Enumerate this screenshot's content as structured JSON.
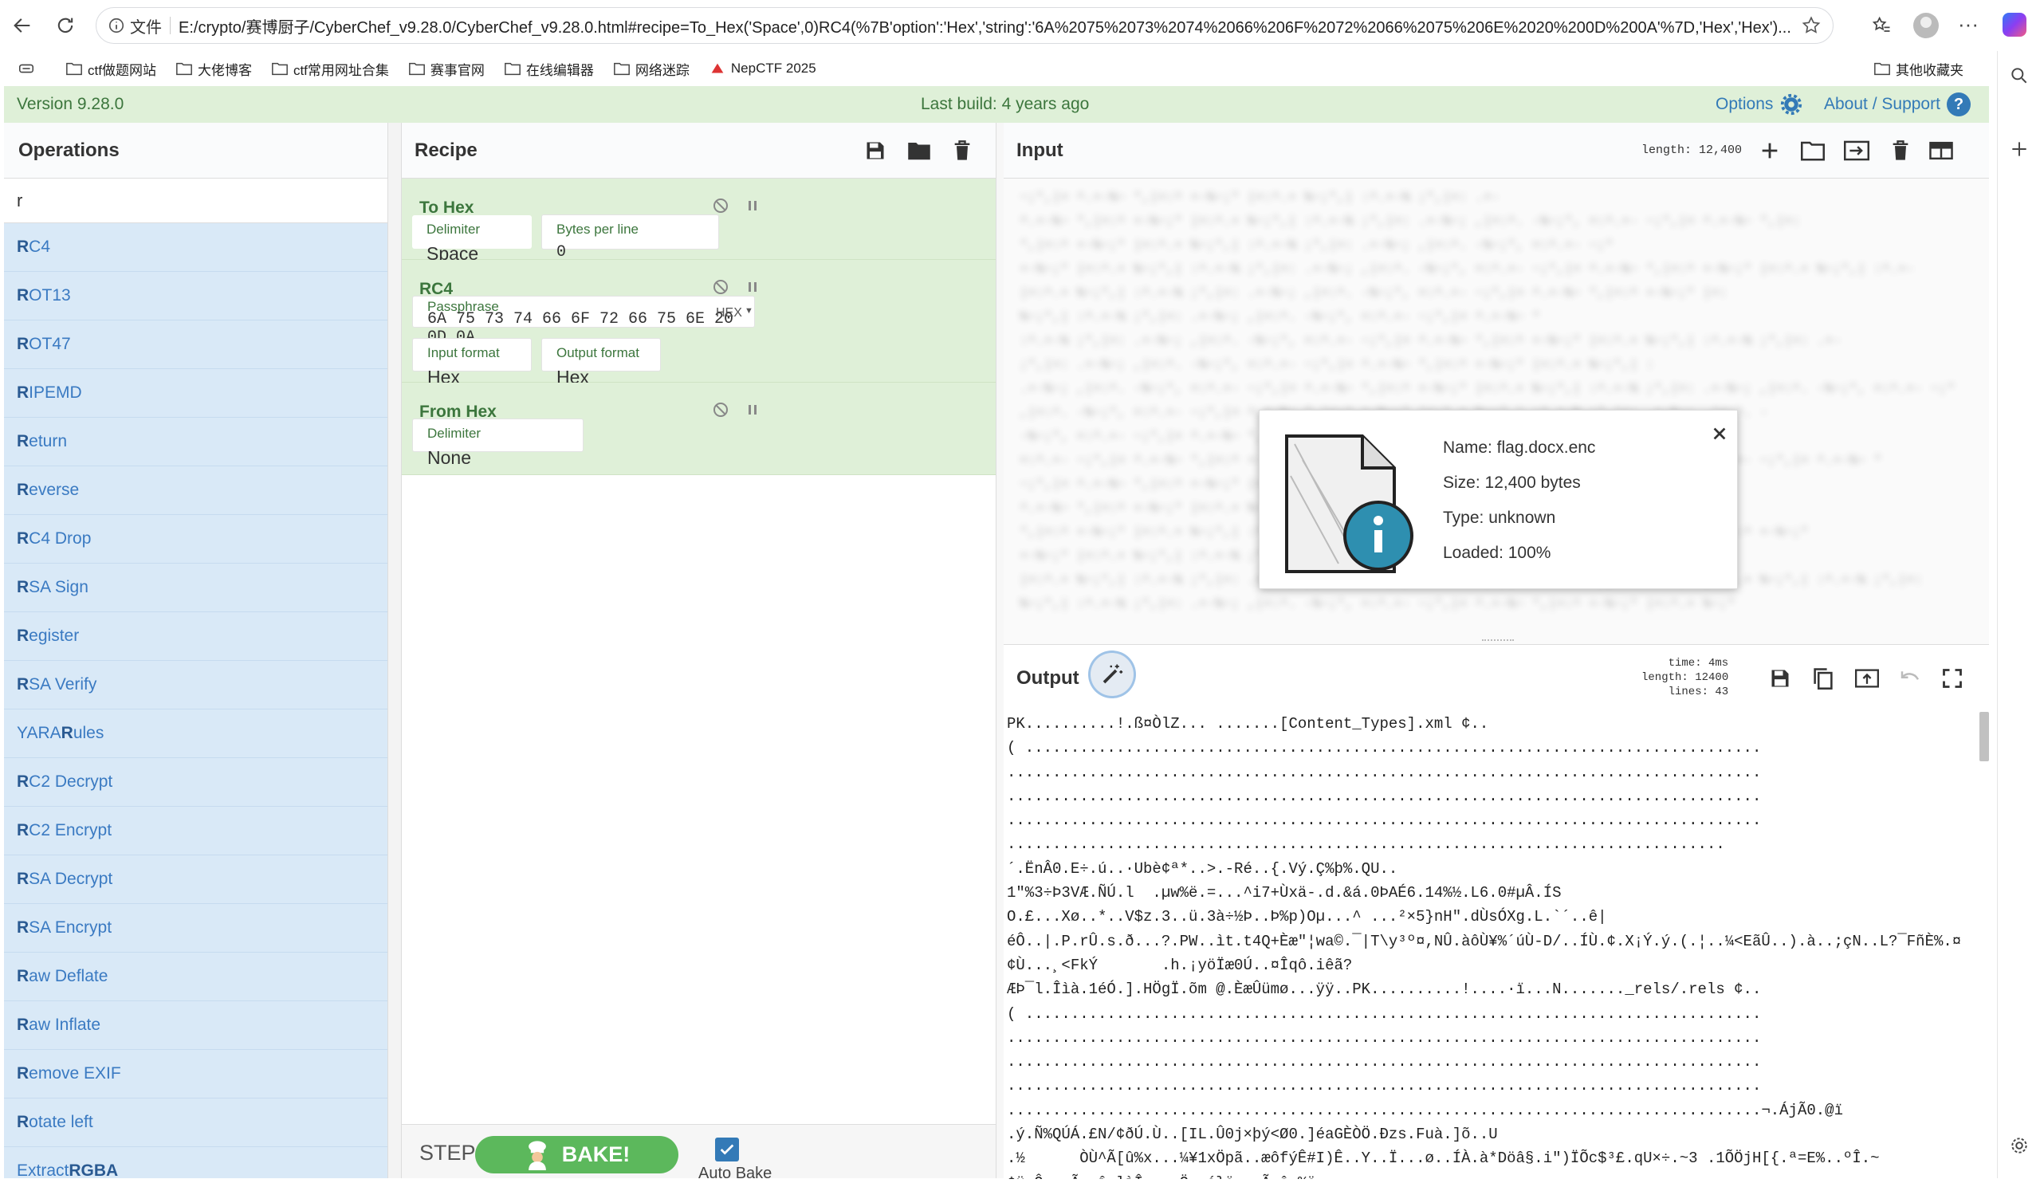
{
  "browser": {
    "url_prefix": "文件",
    "url": "E:/crypto/赛博厨子/CyberChef_v9.28.0/CyberChef_v9.28.0.html#recipe=To_Hex('Space',0)RC4(%7B'option':'Hex','string':'6A%2075%2073%2074%2066%206F%2072%2066%2075%206E%2020%200D%200A'%7D,'Hex','Hex')..."
  },
  "bookmarks": [
    {
      "label": "ctf做题网站"
    },
    {
      "label": "大佬博客"
    },
    {
      "label": "ctf常用网址合集"
    },
    {
      "label": "赛事官网"
    },
    {
      "label": "在线编辑器"
    },
    {
      "label": "网络迷踪"
    },
    {
      "label": "NepCTF 2025"
    }
  ],
  "bookmarks_other": "其他收藏夹",
  "banner": {
    "version": "Version 9.28.0",
    "last_build": "Last build: 4 years ago",
    "options": "Options",
    "about": "About / Support"
  },
  "operations": {
    "title": "Operations",
    "search_value": "r",
    "items": [
      {
        "hl": "R",
        "rest": "C4"
      },
      {
        "hl": "R",
        "rest": "OT13"
      },
      {
        "hl": "R",
        "rest": "OT47"
      },
      {
        "hl": "R",
        "rest": "IPEMD"
      },
      {
        "hl": "R",
        "rest": "eturn"
      },
      {
        "hl": "R",
        "rest": "everse"
      },
      {
        "hl": "R",
        "rest": "C4 Drop"
      },
      {
        "hl": "R",
        "rest": "SA Sign"
      },
      {
        "hl": "R",
        "rest": "egister"
      },
      {
        "hl": "R",
        "rest": "SA Verify"
      },
      {
        "pre": "YARA ",
        "hl": "R",
        "rest": "ules"
      },
      {
        "hl": "R",
        "rest": "C2 Decrypt"
      },
      {
        "hl": "R",
        "rest": "C2 Encrypt"
      },
      {
        "hl": "R",
        "rest": "SA Decrypt"
      },
      {
        "hl": "R",
        "rest": "SA Encrypt"
      },
      {
        "hl": "R",
        "rest": "aw Deflate"
      },
      {
        "hl": "R",
        "rest": "aw Inflate"
      },
      {
        "hl": "R",
        "rest": "emove EXIF"
      },
      {
        "hl": "R",
        "rest": "otate left"
      },
      {
        "pre": "Extract ",
        "hl": "RGBA",
        "rest": ""
      }
    ]
  },
  "recipe": {
    "title": "Recipe",
    "to_hex": {
      "title": "To Hex",
      "delimiter_label": "Delimiter",
      "delimiter_value": "Space",
      "bpl_label": "Bytes per line",
      "bpl_value": "0"
    },
    "rc4": {
      "title": "RC4",
      "pass_label": "Passphrase",
      "pass_value": "6A 75 73 74 66 6F 72 66 75 6E 20 0D 0A",
      "pass_format": "HEX",
      "in_label": "Input format",
      "in_value": "Hex",
      "out_label": "Output format",
      "out_value": "Hex"
    },
    "from_hex": {
      "title": "From Hex",
      "delimiter_label": "Delimiter",
      "delimiter_value": "None"
    },
    "step": "STEP",
    "bake": "BAKE!",
    "auto_bake": "Auto Bake"
  },
  "input": {
    "title": "Input",
    "length": "length: 12,400"
  },
  "file_info": {
    "name": "Name: flag.docx.enc",
    "size": "Size: 12,400 bytes",
    "type": "Type: unknown",
    "loaded": "Loaded: 100%"
  },
  "output": {
    "title": "Output",
    "time": "time:   4ms",
    "length": "length: 12400",
    "lines": "lines:    43",
    "lines_text": [
      "PK..........!.ß¤ÒlZ... .......[Content_Types].xml ¢..",
      "( .................................................................................",
      "...................................................................................",
      "...................................................................................",
      "...................................................................................",
      "...............................................................................",
      "´.ËnÂ0.E÷.ú..·Ubè¢ª*..>.-Ré..{.Vý.Ç%þ%.QU..",
      "1\"%3÷Þ3VÆ.ÑÚ.l  .µw%ë.=...^i7+Ùxä-.d.&á.0ÞAÉ6.14%½.L6.0#µÂ.ÍS",
      "O.£...Xø..*..V$z.3..ü.3à÷½Þ..Þ%p)Oµ...^ ...²×5}nH\".dÙsÓXg.L.`´..ê|",
      "éÔ..|.P.rÛ.s.ð...?.PW..ìt.t4Q+Èæ\"¦wa©.¯|T\\y³º¤,NÛ.àôÙ¥%´úÙ-D/..ÍÙ.¢.X¡Ý.ý.(.¦..¼<EãÛ..).à..;çN..L?¯FñÈ%.¤",
      "¢Ù...¸<FkÝ       .h.¡yöÏæ0Ú..¤Îqô.iêã?",
      "ÆÞ¯l.Îìà.1éÓ.].HÖgÏ.õm @.ÈæÛümø...ÿÿ..PK..........!....·ï...N......._rels/.rels ¢..",
      "( .................................................................................",
      "...................................................................................",
      "...................................................................................",
      "...................................................................................",
      "...................................................................................¬.ÁjÃ0.@ï",
      ".ý.Ñ%QÚÁ.£N/¢ðÚ.Ù..[IL.Û0j×þý<Ø0.]éaGÈÒÖ.Ðzs.Fuà.]õ..U",
      ".½      ÒÙ^Ã[û%x...¼¥1xÖpã..æôfýÊ#I)Ê..Y..Ï...ø..ÍÀ.à*Döâ§.i\")ÏÕc$³£.qU×÷.~3 .1ÕÖjH[{.ª=E%..ºÎ.~",
      "¢ü.Ô...Ã..î.lìÎ«...Ö..á}ë...Ã.ô.%ö..."
    ]
  }
}
